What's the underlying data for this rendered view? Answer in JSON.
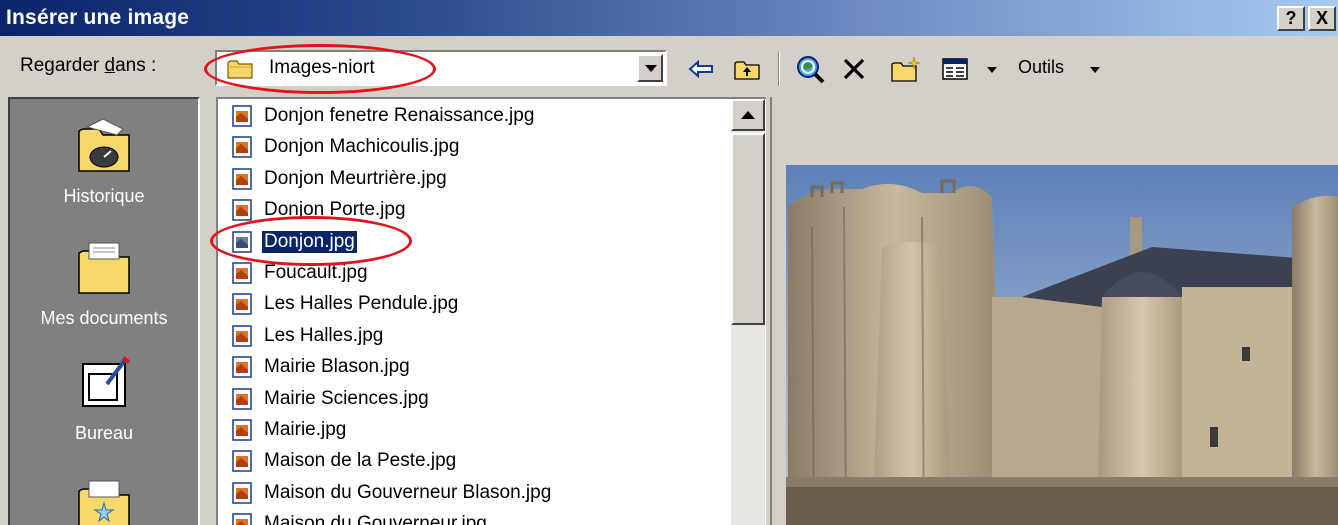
{
  "window": {
    "title": "Insérer une image",
    "help_btn": "?",
    "close_btn": "X"
  },
  "toolbar": {
    "lookin_prefix": "Regarder ",
    "lookin_underlined": "d",
    "lookin_suffix": "ans :",
    "current_folder": "Images-niort",
    "tools_label": "Outils"
  },
  "places": [
    {
      "label": "Historique",
      "icon": "history-icon"
    },
    {
      "label": "Mes documents",
      "icon": "my-documents-icon"
    },
    {
      "label": "Bureau",
      "icon": "desktop-icon"
    },
    {
      "label": "",
      "icon": "favorites-icon"
    }
  ],
  "files": [
    {
      "name": "Donjon fenetre Renaissance.jpg",
      "selected": false
    },
    {
      "name": "Donjon Machicoulis.jpg",
      "selected": false
    },
    {
      "name": "Donjon Meurtrière.jpg",
      "selected": false
    },
    {
      "name": "Donjon Porte.jpg",
      "selected": false
    },
    {
      "name": "Donjon.jpg",
      "selected": true
    },
    {
      "name": "Foucault.jpg",
      "selected": false
    },
    {
      "name": "Les Halles Pendule.jpg",
      "selected": false
    },
    {
      "name": "Les Halles.jpg",
      "selected": false
    },
    {
      "name": "Mairie Blason.jpg",
      "selected": false
    },
    {
      "name": "Mairie Sciences.jpg",
      "selected": false
    },
    {
      "name": "Mairie.jpg",
      "selected": false
    },
    {
      "name": "Maison de la Peste.jpg",
      "selected": false
    },
    {
      "name": "Maison du Gouverneur Blason.jpg",
      "selected": false
    },
    {
      "name": "Maison du Gouverneur.jpg",
      "selected": false
    }
  ],
  "colors": {
    "selection": "#0a246a",
    "annotation": "#e0141a",
    "face": "#d4d0c8",
    "places_bg": "#808080"
  }
}
